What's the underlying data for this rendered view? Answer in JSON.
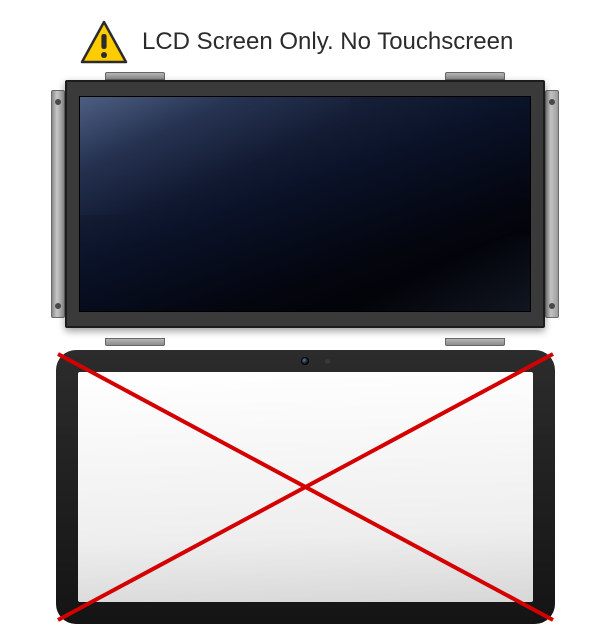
{
  "header": {
    "text": "LCD Screen Only. No Touchscreen"
  },
  "icons": {
    "warning": "warning-icon"
  },
  "colors": {
    "warning_fill": "#ffcc00",
    "warning_stroke": "#2b2b2b",
    "cross": "#d40000"
  }
}
